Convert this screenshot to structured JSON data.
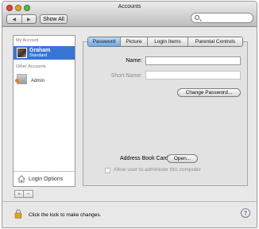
{
  "window": {
    "title": "Accounts",
    "nav_back": "◀",
    "nav_forward": "▶",
    "show_all": "Show All",
    "search_placeholder": ""
  },
  "sidebar": {
    "my_account_header": "My Account",
    "selected_account": {
      "name": "Graham",
      "role": "Standard"
    },
    "other_accounts_header": "Other Accounts",
    "other_accounts": [
      {
        "name": "Admin"
      }
    ],
    "login_options": "Login Options",
    "add_symbol": "+",
    "remove_symbol": "−"
  },
  "tabs": [
    {
      "label": "Password",
      "active": true
    },
    {
      "label": "Picture",
      "active": false
    },
    {
      "label": "Login Items",
      "active": false
    },
    {
      "label": "Parental Controls",
      "active": false
    }
  ],
  "password_panel": {
    "name_label": "Name:",
    "name_value": "",
    "short_name_label": "Short Name:",
    "short_name_value": "",
    "change_password_button": "Change Password...",
    "address_book_label": "Address Book Card:",
    "open_button": "Open...",
    "admin_checkbox_label": "Allow user to administer this computer",
    "admin_checkbox_checked": false
  },
  "footer": {
    "lock_text": "Click the lock to make changes.",
    "help_symbol": "?"
  },
  "colors": {
    "selection": "#3875d7",
    "active_tab": "#6ea6e3",
    "help_glyph": "#4a3ad2"
  }
}
